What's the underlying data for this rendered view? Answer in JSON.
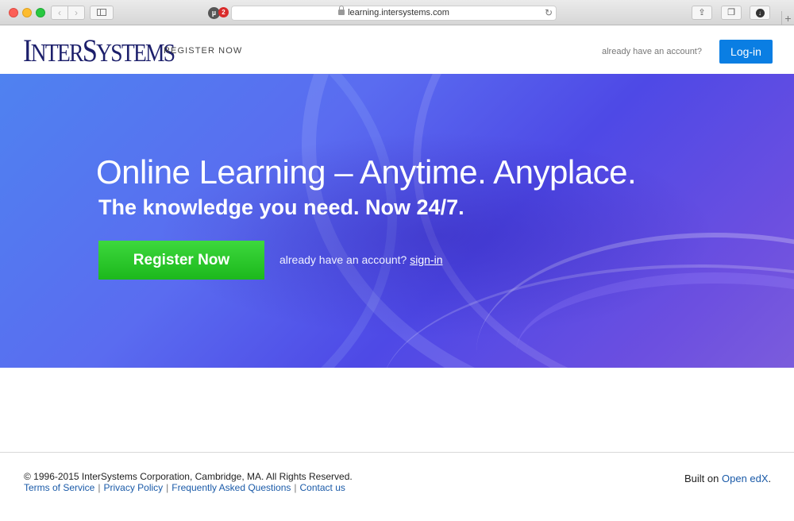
{
  "browser": {
    "url": "learning.intersystems.com",
    "ublock_badge": "2",
    "ublock_label": "µ"
  },
  "header": {
    "logo_first": "I",
    "logo_rest1": "NTER",
    "logo_second": "S",
    "logo_rest2": "YSTEMS",
    "register_nav": "REGISTER NOW",
    "account_prompt": "already have an account?",
    "login_label": "Log-in"
  },
  "hero": {
    "title": "Online Learning – Anytime. Anyplace.",
    "subtitle": "The knowledge you need. Now 24/7.",
    "register_label": "Register Now",
    "account_prompt": "already have an account?",
    "signin_label": "sign-in"
  },
  "footer": {
    "copyright": "© 1996-2015 InterSystems Corporation, Cambridge, MA. All Rights Reserved.",
    "links": [
      "Terms of Service",
      "Privacy Policy",
      "Frequently Asked Questions",
      "Contact us"
    ],
    "separator": "|",
    "built_on_prefix": "Built on",
    "built_on_link": "Open edX",
    "built_on_suffix": "."
  },
  "colors": {
    "brand": "#1c1f6b",
    "login_button": "#0a7ee3",
    "register_button": "#22c022",
    "link": "#1a5aa8"
  }
}
